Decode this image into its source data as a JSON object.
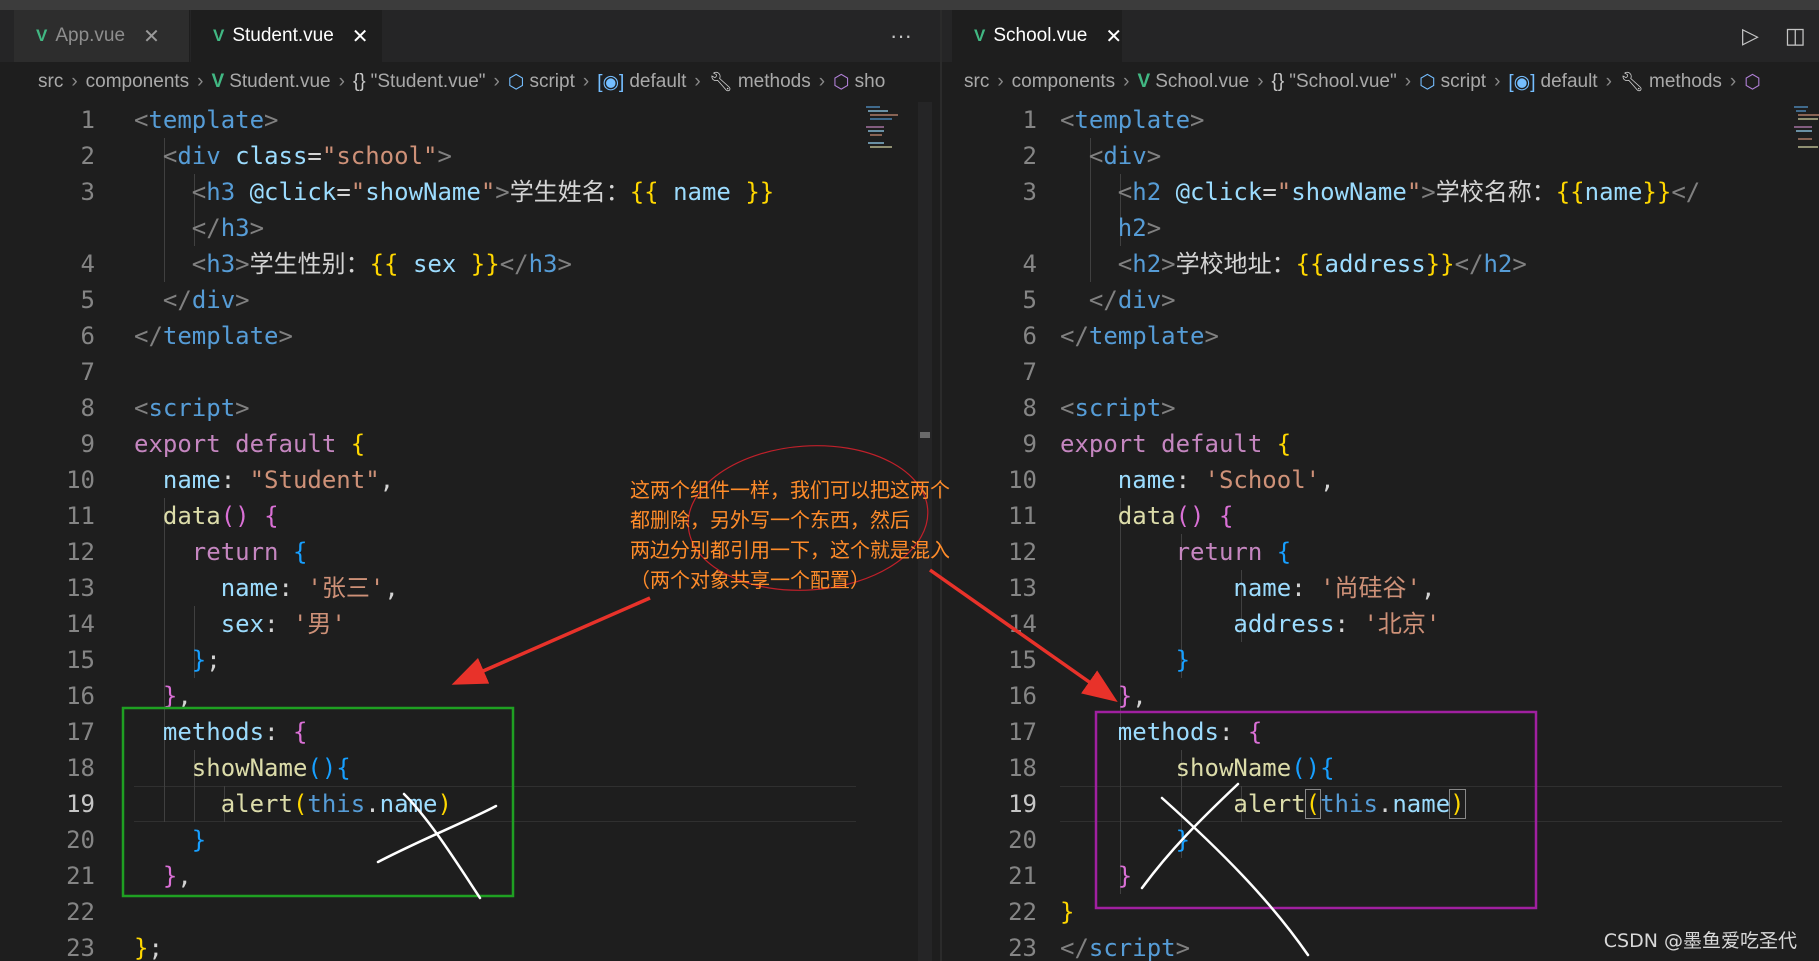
{
  "left": {
    "tabs": [
      {
        "label": "App.vue",
        "active": false
      },
      {
        "label": "Student.vue",
        "active": true
      }
    ],
    "more_actions": "···",
    "breadcrumb": [
      "src",
      "components",
      "Student.vue",
      "\"Student.vue\"",
      "script",
      "default",
      "methods",
      "sho"
    ],
    "lines": [
      {
        "n": "1"
      },
      {
        "n": "2"
      },
      {
        "n": "3"
      },
      {
        "n": ""
      },
      {
        "n": "4"
      },
      {
        "n": "5"
      },
      {
        "n": "6"
      },
      {
        "n": "7"
      },
      {
        "n": "8"
      },
      {
        "n": "9"
      },
      {
        "n": "10"
      },
      {
        "n": "11"
      },
      {
        "n": "12"
      },
      {
        "n": "13"
      },
      {
        "n": "14"
      },
      {
        "n": "15"
      },
      {
        "n": "16"
      },
      {
        "n": "17"
      },
      {
        "n": "18"
      },
      {
        "n": "19"
      },
      {
        "n": "20"
      },
      {
        "n": "21"
      },
      {
        "n": "22"
      },
      {
        "n": "23"
      }
    ],
    "code": {
      "l3_text": "学生姓名：",
      "l4_text": "学生性别：",
      "name_value": "\"Student\"",
      "zhangsan": "'张三'",
      "nan": "'男'"
    }
  },
  "right": {
    "tabs": [
      {
        "label": "School.vue",
        "active": true
      }
    ],
    "breadcrumb": [
      "src",
      "components",
      "School.vue",
      "\"School.vue\"",
      "script",
      "default",
      "methods"
    ],
    "code": {
      "l3_text": "学校名称：",
      "l4_text": "学校地址：",
      "name_value": "'School'",
      "shangguigu": "'尚硅谷'",
      "beijing": "'北京'"
    }
  },
  "annotation": {
    "lines": [
      "这两个组件一样，我们可以把这两个",
      "都删除，另外写一个东西，然后",
      "两边分别都引用一下，这个就是混入",
      "（两个对象共享一个配置）"
    ],
    "colors": {
      "text": "#ff8c2a",
      "arrow": "#e8322a",
      "left_box": "#1fa022",
      "right_box": "#a020a0",
      "circle": "#c0202a"
    }
  },
  "watermark": "CSDN @墨鱼爱吃圣代",
  "colors": {
    "vue_green": "#41b883",
    "editor_bg": "#1e1e1e",
    "tabbar_bg": "#252526"
  },
  "icons": {
    "vue": "vue-file-icon",
    "close": "close-icon",
    "more": "more-actions-icon",
    "run": "run-icon",
    "split": "split-editor-icon"
  }
}
